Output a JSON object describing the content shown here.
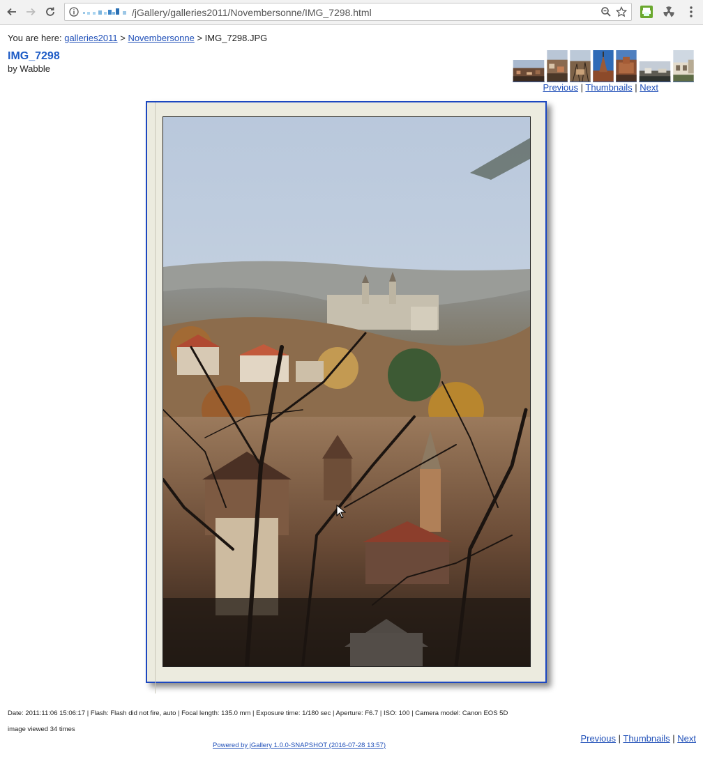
{
  "browser": {
    "url": "/jGallery/galleries2011/Novembersonne/IMG_7298.html"
  },
  "breadcrumb": {
    "prefix": "You are here:",
    "links": [
      "galleries2011",
      "Novembersonne"
    ],
    "separator": ">",
    "current": "IMG_7298.JPG"
  },
  "image": {
    "title": "IMG_7298",
    "author": "by Wabble"
  },
  "pager": {
    "previous": "Previous",
    "thumbnails": "Thumbnails",
    "next": "Next",
    "separator": "|"
  },
  "exif": {
    "text": "Date: 2011:11:06 15:06:17 | Flash: Flash did not fire, auto | Focal length: 135.0 mm | Exposure time: 1/180 sec | Aperture: F6.7 | ISO: 100 | Camera model: Canon EOS 5D"
  },
  "views": "image viewed 34 times",
  "powered": "Powered by jGallery 1.0.0-SNAPSHOT (2016-07-28 13:57)",
  "colors": {
    "link": "#1f4fb8",
    "title": "#1e5cc6",
    "frame_border": "#1c47c0",
    "frame_mat": "#ecebdf"
  }
}
